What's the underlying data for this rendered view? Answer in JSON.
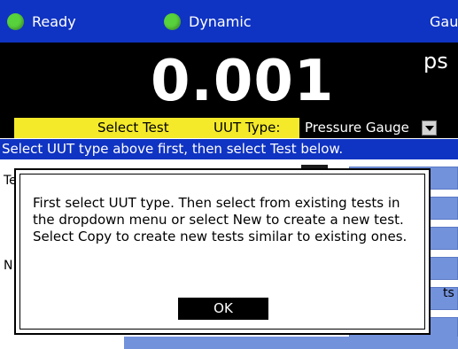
{
  "status_bar": {
    "ready_label": "Ready",
    "dynamic_label": "Dynamic",
    "gauge_label": "Gauge",
    "led_color": "#58d23c",
    "bar_color": "#0f33c2"
  },
  "reading": {
    "value": "0.001",
    "unit": "ps"
  },
  "select_row": {
    "select_test_label": "Select Test",
    "uut_type_label": "UUT Type:",
    "uut_type_value": "Pressure Gauge",
    "highlight_color": "#f5ea2a"
  },
  "instruction": "Select UUT type above first, then select Test below.",
  "background_form": {
    "label_te": "Te",
    "label_n": "N",
    "label_ts": "ts",
    "button_color": "#7392dc"
  },
  "dialog": {
    "message": "First select UUT type. Then select from existing tests in the dropdown menu or select New to create a new test. Select Copy to create new tests similar to existing ones.",
    "ok_label": "OK"
  }
}
